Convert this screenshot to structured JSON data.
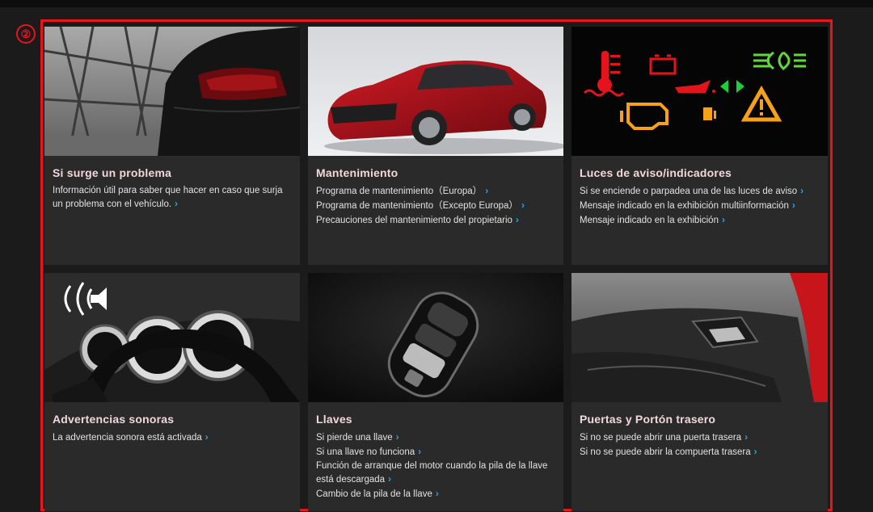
{
  "marker": "②",
  "cards": [
    {
      "title": "Si surge un problema",
      "links": [
        "Información útil para saber que hacer en caso que surja un problema con el vehículo."
      ]
    },
    {
      "title": "Mantenimiento",
      "links": [
        "Programa de mantenimiento（Europa）",
        "Programa de mantenimiento（Excepto Europa）",
        "Precauciones del mantenimiento del propietario"
      ]
    },
    {
      "title": "Luces de aviso/indicadores",
      "links": [
        "Si se enciende o parpadea una de las luces de aviso",
        "Mensaje indicado en la exhibición multiinformación",
        "Mensaje indicado en la exhibición"
      ]
    },
    {
      "title": "Advertencias sonoras",
      "links": [
        "La advertencia sonora está activada"
      ]
    },
    {
      "title": "Llaves",
      "links": [
        "Si pierde una llave",
        "Si una llave no funciona",
        "Función de arranque del motor cuando la pila de la llave está descargada",
        "Cambio de la pila de la llave"
      ]
    },
    {
      "title": "Puertas y Portón trasero",
      "links": [
        "Si no se puede abrir una puerta trasera",
        "Si no se puede abrir la compuerta trasera"
      ]
    }
  ],
  "chevron": "›",
  "colors": {
    "accent": "#e8161b",
    "link_chevron": "#1fa6f0",
    "title": "#f2d8dd"
  }
}
